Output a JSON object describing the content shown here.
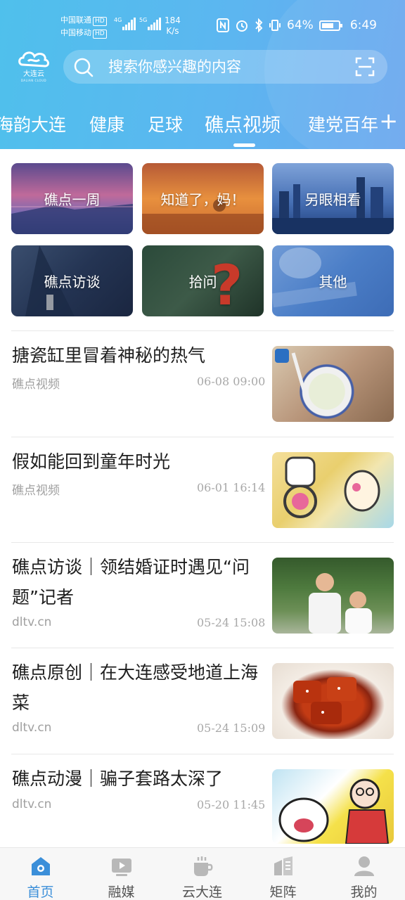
{
  "status_bar": {
    "carrier_1": "中国联通",
    "carrier_2": "中国移动",
    "hd_badge": "HD",
    "network_1": "4G",
    "network_2": "5G",
    "speed_value": "184",
    "speed_unit": "K/s",
    "battery": "64%",
    "time": "6:49"
  },
  "app": {
    "logo_text": "大连云",
    "logo_sub": "DALIAN CLOUD"
  },
  "search": {
    "placeholder": "搜索你感兴趣的内容"
  },
  "channels": {
    "items": [
      "海韵大连",
      "健康",
      "足球",
      "礁点视频",
      "建党百年"
    ],
    "active": "礁点视频",
    "add_label": "+"
  },
  "categories": [
    {
      "label": "礁点一周"
    },
    {
      "label": "知道了，妈！"
    },
    {
      "label": "另眼相看"
    },
    {
      "label": "礁点访谈"
    },
    {
      "label": "拾问"
    },
    {
      "label": "其他"
    }
  ],
  "news": [
    {
      "title": "搪瓷缸里冒着神秘的热气",
      "source": "礁点视频",
      "time": "06-08 09:00"
    },
    {
      "title": "假如能回到童年时光",
      "source": "礁点视频",
      "time": "06-01 16:14"
    },
    {
      "title": "礁点访谈｜领结婚证时遇见“问题”记者",
      "source": "dltv.cn",
      "time": "05-24 15:08"
    },
    {
      "title": "礁点原创｜在大连感受地道上海菜",
      "source": "dltv.cn",
      "time": "05-24 15:09"
    },
    {
      "title": "礁点动漫｜骗子套路太深了",
      "source": "dltv.cn",
      "time": "05-20 11:45"
    }
  ],
  "bottom_nav": {
    "items": [
      {
        "label": "首页",
        "icon": "home-icon"
      },
      {
        "label": "融媒",
        "icon": "media-play-icon"
      },
      {
        "label": "云大连",
        "icon": "cup-icon"
      },
      {
        "label": "矩阵",
        "icon": "building-icon"
      },
      {
        "label": "我的",
        "icon": "person-icon"
      }
    ],
    "active": "首页",
    "active_color": "#3b8fd9"
  },
  "colors": {
    "header_gradient_start": "#4fc0ec",
    "header_gradient_end": "#6aa6ee"
  }
}
